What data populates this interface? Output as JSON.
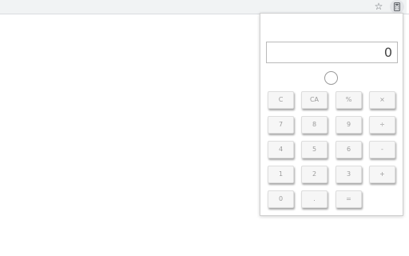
{
  "toolbar": {
    "star_icon": "star-outline-icon",
    "extension_icon": "calculator-icon"
  },
  "calculator": {
    "display_value": "0",
    "keys": {
      "clear": "C",
      "clear_all": "CA",
      "percent": "%",
      "multiply": "×",
      "seven": "7",
      "eight": "8",
      "nine": "9",
      "divide": "÷",
      "four": "4",
      "five": "5",
      "six": "6",
      "minus": "-",
      "one": "1",
      "two": "2",
      "three": "3",
      "plus": "+",
      "zero": "0",
      "decimal": ".",
      "equals": "="
    }
  }
}
